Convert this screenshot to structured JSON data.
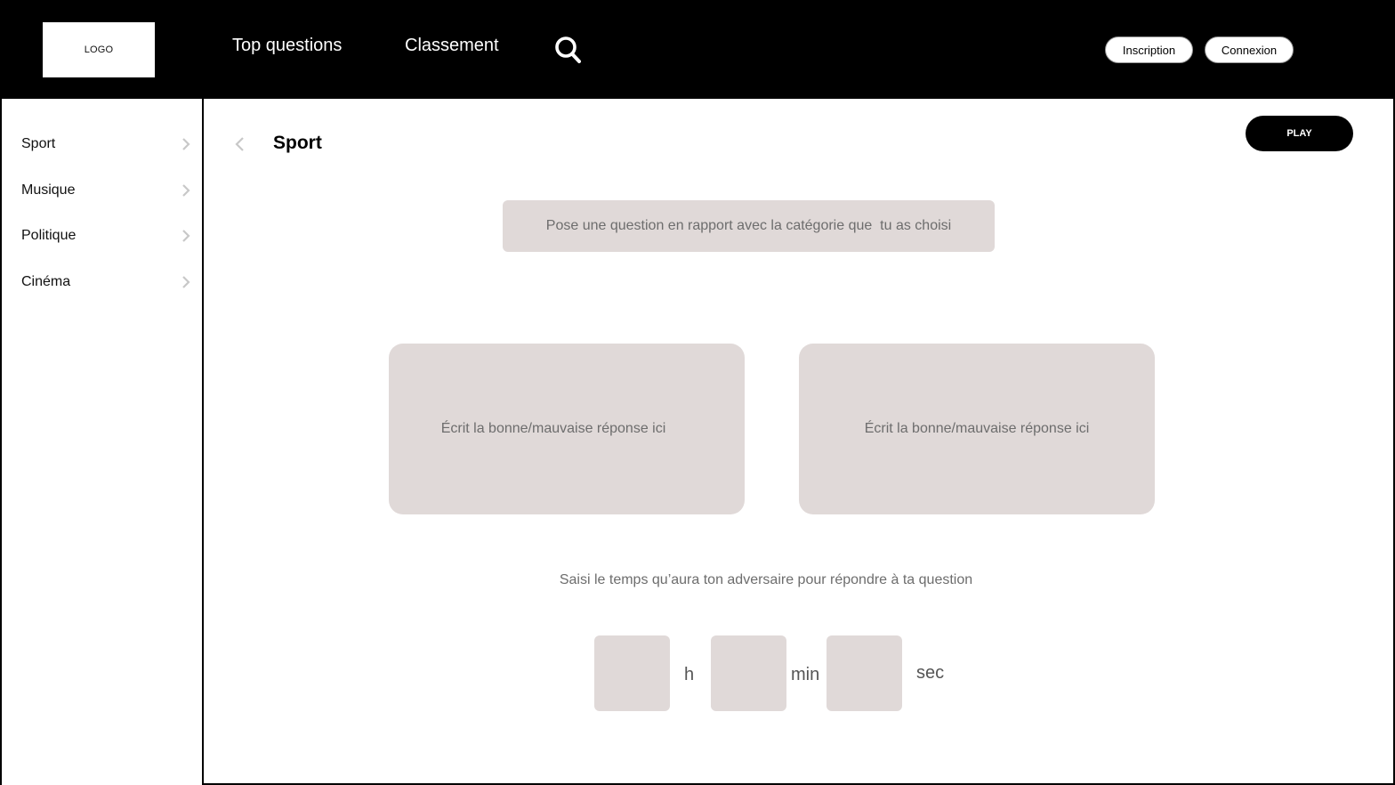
{
  "header": {
    "logo_text": "LOGO",
    "nav": {
      "top_questions": "Top questions",
      "ranking": "Classement"
    },
    "search_icon": "search-icon",
    "signup_label": "Inscription",
    "login_label": "Connexion"
  },
  "sidebar": {
    "items": [
      {
        "label": "Sport"
      },
      {
        "label": "Musique"
      },
      {
        "label": "Politique"
      },
      {
        "label": "Cinéma"
      }
    ]
  },
  "main": {
    "title": "Sport",
    "play_label": "PLAY",
    "question_placeholder": "Pose une question en rapport avec la catégorie que  tu as choisi",
    "answers": [
      {
        "placeholder": "Écrit la bonne/mauvaise réponse ici"
      },
      {
        "placeholder": "Écrit la bonne/mauvaise réponse ici"
      }
    ],
    "time_prompt": "Saisi le temps qu’aura ton adversaire pour répondre à ta question",
    "time_units": {
      "hours": "h",
      "minutes": "min",
      "seconds": "sec"
    },
    "time_values": {
      "hours": "",
      "minutes": "",
      "seconds": ""
    }
  },
  "colors": {
    "header_bg": "#000000",
    "field_bg": "#e0d9d8",
    "placeholder_text": "#6d6d6d",
    "chevron": "#c8c8c8"
  }
}
